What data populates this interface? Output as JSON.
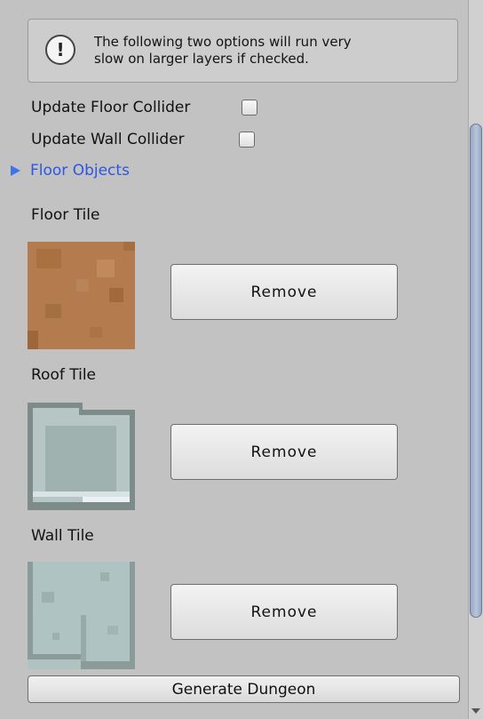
{
  "help": {
    "line1": "The following two options will run very",
    "line2": "slow on larger layers if checked.",
    "icon": "info-icon"
  },
  "toggles": {
    "floor_collider": {
      "label": "Update Floor Collider",
      "checked": false
    },
    "wall_collider": {
      "label": "Update Wall Collider",
      "checked": false
    }
  },
  "foldout": {
    "label": "Floor Objects",
    "expanded": false,
    "color": "#2b57e3"
  },
  "tiles": [
    {
      "label": "Floor Tile",
      "button": "Remove"
    },
    {
      "label": "Roof Tile",
      "button": "Remove"
    },
    {
      "label": "Wall Tile",
      "button": "Remove"
    }
  ],
  "generate_button": "Generate Dungeon",
  "colors": {
    "background": "#c2c2c2",
    "floor_tile": "#b37b4e",
    "roof_tile": "#8a9a98",
    "wall_tile": "#afc3c2",
    "accent": "#3f73e8"
  }
}
